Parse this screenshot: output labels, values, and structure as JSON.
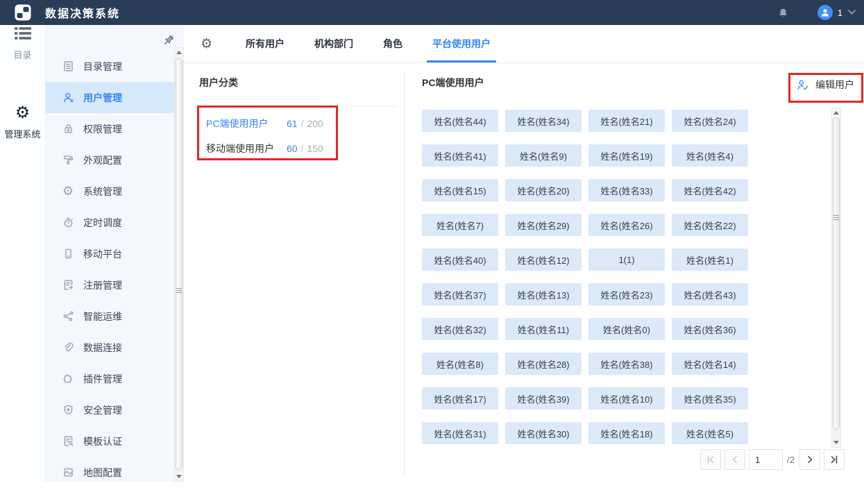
{
  "topbar": {
    "title": "数据决策系统",
    "user": "1"
  },
  "rail": {
    "items": [
      {
        "label": "目录",
        "icon": "catalog-list-icon",
        "active": false
      },
      {
        "label": "管理系统",
        "icon": "management-gear-icon",
        "active": true
      }
    ]
  },
  "sidebar": {
    "items": [
      {
        "label": "目录管理",
        "icon": "directory-doc-icon",
        "selected": false
      },
      {
        "label": "用户管理",
        "icon": "user-icon",
        "selected": true
      },
      {
        "label": "权限管理",
        "icon": "lock-icon",
        "selected": false
      },
      {
        "label": "外观配置",
        "icon": "paint-roller-icon",
        "selected": false
      },
      {
        "label": "系统管理",
        "icon": "system-gear-icon",
        "selected": false
      },
      {
        "label": "定时调度",
        "icon": "timer-icon",
        "selected": false
      },
      {
        "label": "移动平台",
        "icon": "mobile-icon",
        "selected": false
      },
      {
        "label": "注册管理",
        "icon": "doc-plus-icon",
        "selected": false
      },
      {
        "label": "智能运维",
        "icon": "nodes-icon",
        "selected": false
      },
      {
        "label": "数据连接",
        "icon": "paperclip-icon",
        "selected": false
      },
      {
        "label": "插件管理",
        "icon": "puzzle-icon",
        "selected": false
      },
      {
        "label": "安全管理",
        "icon": "shield-plus-icon",
        "selected": false
      },
      {
        "label": "模板认证",
        "icon": "doc-search-icon",
        "selected": false
      },
      {
        "label": "地图配置",
        "icon": "map-icon",
        "selected": false
      }
    ]
  },
  "tabs": {
    "items": [
      {
        "label": "所有用户",
        "active": false
      },
      {
        "label": "机构部门",
        "active": false
      },
      {
        "label": "角色",
        "active": false
      },
      {
        "label": "平台使用用户",
        "active": true
      }
    ]
  },
  "category_panel": {
    "title": "用户分类",
    "separator": "/",
    "items": [
      {
        "label": "PC端使用用户",
        "count": "61",
        "total": "200",
        "selected": true
      },
      {
        "label": "移动端使用用户",
        "count": "60",
        "total": "150",
        "selected": false
      }
    ]
  },
  "users_panel": {
    "title": "PC端使用用户",
    "edit_button": "编辑用户",
    "users": [
      "姓名(姓名44)",
      "姓名(姓名34)",
      "姓名(姓名21)",
      "姓名(姓名24)",
      "姓名(姓名41)",
      "姓名(姓名9)",
      "姓名(姓名19)",
      "姓名(姓名4)",
      "姓名(姓名15)",
      "姓名(姓名20)",
      "姓名(姓名33)",
      "姓名(姓名42)",
      "姓名(姓名7)",
      "姓名(姓名29)",
      "姓名(姓名26)",
      "姓名(姓名22)",
      "姓名(姓名40)",
      "姓名(姓名12)",
      "1(1)",
      "姓名(姓名1)",
      "姓名(姓名37)",
      "姓名(姓名13)",
      "姓名(姓名23)",
      "姓名(姓名43)",
      "姓名(姓名32)",
      "姓名(姓名11)",
      "姓名(姓名0)",
      "姓名(姓名36)",
      "姓名(姓名8)",
      "姓名(姓名28)",
      "姓名(姓名38)",
      "姓名(姓名14)",
      "姓名(姓名17)",
      "姓名(姓名39)",
      "姓名(姓名10)",
      "姓名(姓名35)",
      "姓名(姓名31)",
      "姓名(姓名30)",
      "姓名(姓名18)",
      "姓名(姓名5)"
    ]
  },
  "pagination": {
    "page": "1",
    "total": "/2"
  },
  "colors": {
    "accent": "#3685f2",
    "topbar": "#2b3c56",
    "annotation": "#e42525",
    "pill_bg": "#dbe9f8",
    "selected_menu_bg": "#d6e9fc"
  }
}
